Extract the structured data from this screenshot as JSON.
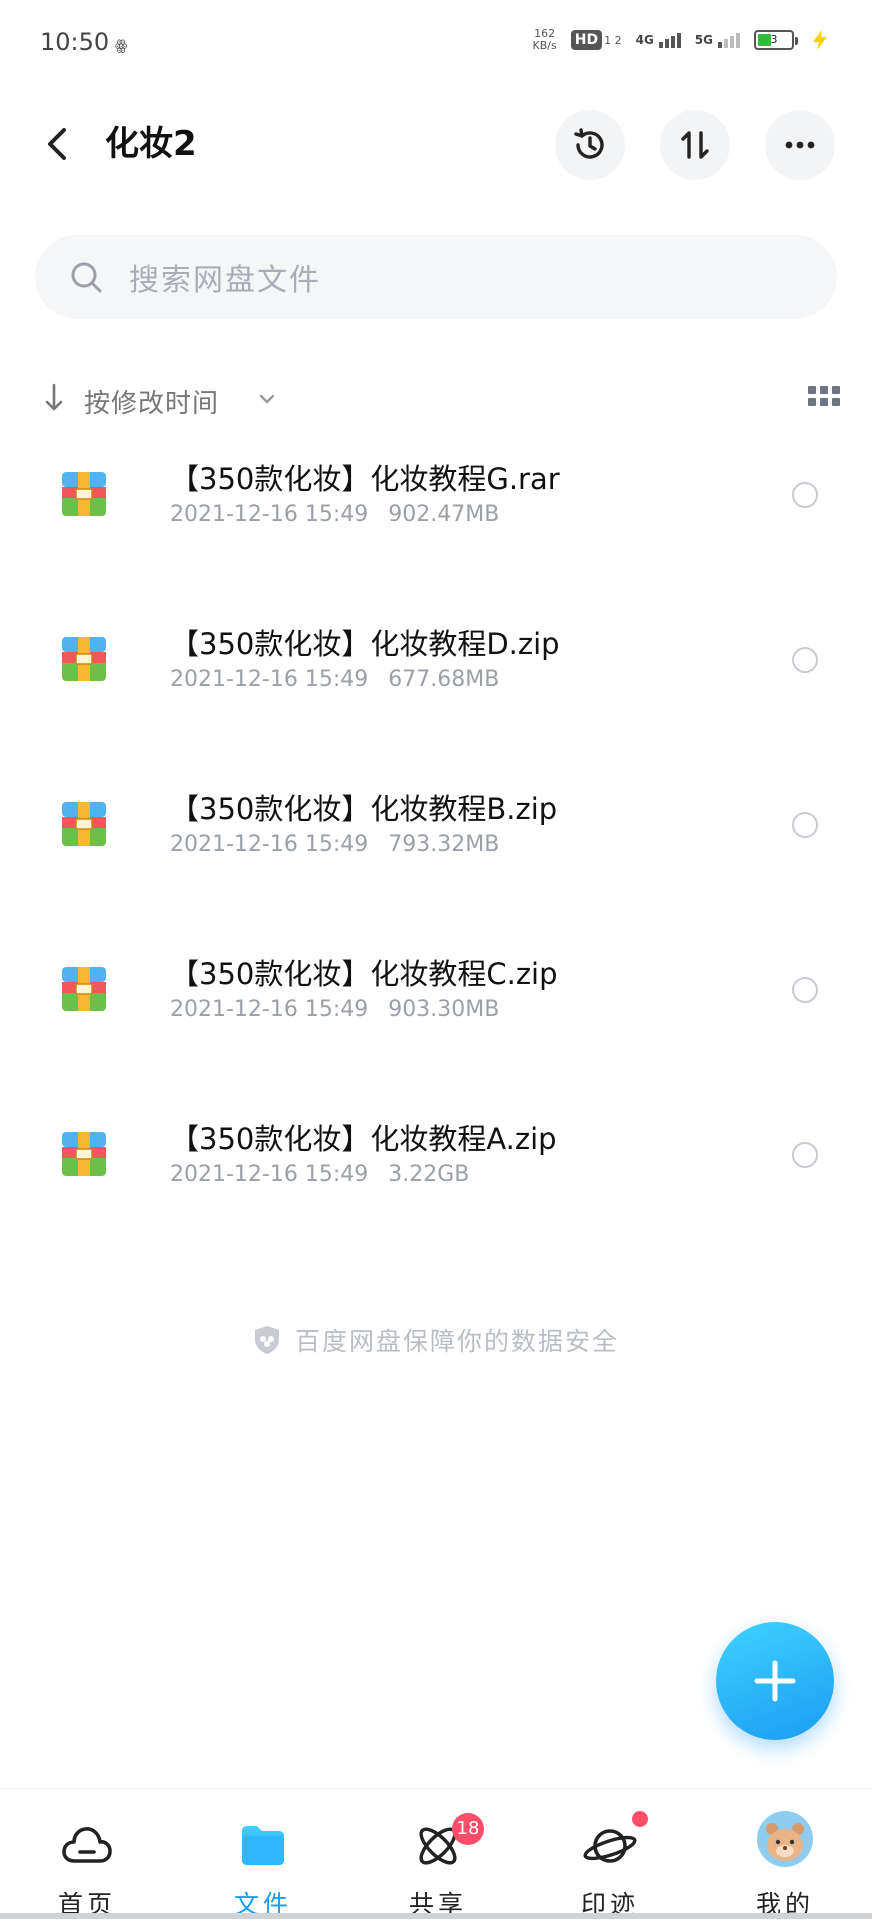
{
  "status_bar": {
    "time": "10:50",
    "indicator": "ꙮ",
    "net_speed_value": "162",
    "net_speed_unit": "KB/s",
    "hd_label": "HD",
    "hd_sub": "1 2",
    "signal_1_label": "4G",
    "signal_2_label": "5G",
    "battery_level": "3",
    "battery_color": "#2fbd3b"
  },
  "header": {
    "title": "化妆2",
    "back_icon": "chevron-left-icon",
    "history_icon": "history-icon",
    "transfer_icon": "transfer-icon",
    "more_icon": "more-icon"
  },
  "search": {
    "placeholder": "搜索网盘文件"
  },
  "sort": {
    "label": "按修改时间"
  },
  "files": [
    {
      "name": "【350款化妆】化妆教程G.rar",
      "date": "2021-12-16 15:49",
      "size": "902.47MB"
    },
    {
      "name": "【350款化妆】化妆教程D.zip",
      "date": "2021-12-16 15:49",
      "size": "677.68MB"
    },
    {
      "name": "【350款化妆】化妆教程B.zip",
      "date": "2021-12-16 15:49",
      "size": "793.32MB"
    },
    {
      "name": "【350款化妆】化妆教程C.zip",
      "date": "2021-12-16 15:49",
      "size": "903.30MB"
    },
    {
      "name": "【350款化妆】化妆教程A.zip",
      "date": "2021-12-16 15:49",
      "size": "3.22GB"
    }
  ],
  "footer_note": "百度网盘保障你的数据安全",
  "nav": {
    "items": [
      {
        "label": "首页",
        "icon": "home-cloud-icon"
      },
      {
        "label": "文件",
        "icon": "folder-icon",
        "active": true
      },
      {
        "label": "共享",
        "icon": "share-atom-icon",
        "badge": "18"
      },
      {
        "label": "印迹",
        "icon": "planet-icon"
      },
      {
        "label": "我的",
        "icon": "avatar-icon"
      }
    ]
  },
  "colors": {
    "accent": "#1a9cf2",
    "badge": "#ff4d6a"
  }
}
